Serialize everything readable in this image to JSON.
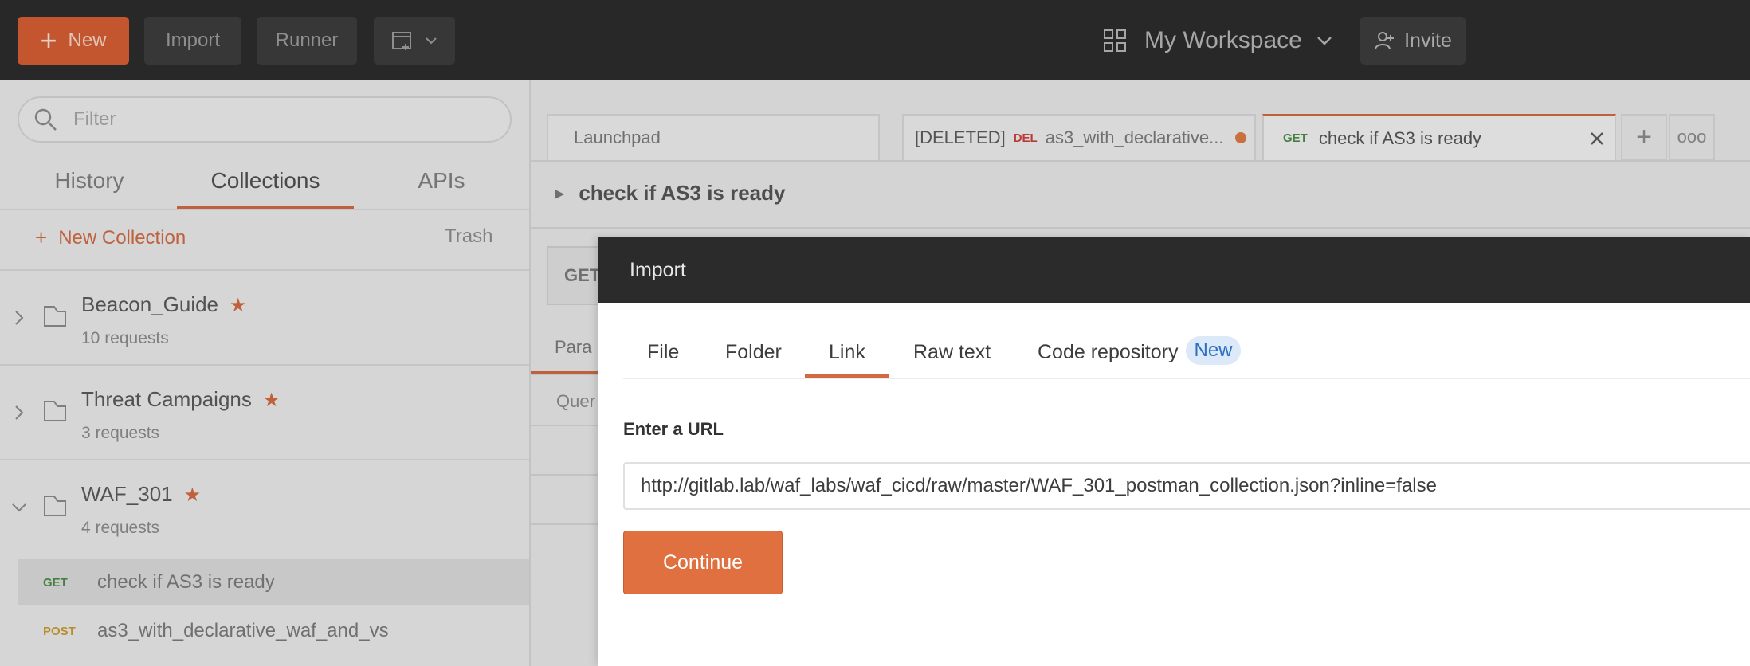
{
  "topbar": {
    "new_label": "New",
    "import_label": "Import",
    "runner_label": "Runner",
    "workspace_label": "My Workspace",
    "invite_label": "Invite"
  },
  "sidebar": {
    "filter_placeholder": "Filter",
    "tabs": [
      "History",
      "Collections",
      "APIs"
    ],
    "active_tab": "Collections",
    "new_collection_label": "New Collection",
    "trash_label": "Trash",
    "collections": [
      {
        "name": "Beacon_Guide",
        "requests": "10 requests",
        "starred": true,
        "expanded": false
      },
      {
        "name": "Threat Campaigns",
        "requests": "3 requests",
        "starred": true,
        "expanded": false
      },
      {
        "name": "WAF_301",
        "requests": "4 requests",
        "starred": true,
        "expanded": true
      }
    ],
    "requests": [
      {
        "method": "GET",
        "name": "check if AS3 is ready",
        "active": true
      },
      {
        "method": "POST",
        "name": "as3_with_declarative_waf_and_vs",
        "active": false
      }
    ]
  },
  "tabs": {
    "launchpad": "Launchpad",
    "deleted_prefix": "[DELETED]",
    "deleted_method": "DEL",
    "deleted_name": "as3_with_declarative...",
    "active_method": "GET",
    "active_name": "check if AS3 is ready"
  },
  "main": {
    "request_title": "check if AS3 is ready",
    "method": "GET",
    "params_tab": "Para",
    "query_label": "Quer"
  },
  "modal": {
    "title": "Import",
    "tabs": [
      "File",
      "Folder",
      "Link",
      "Raw text",
      "Code repository"
    ],
    "active_tab": "Link",
    "new_badge": "New",
    "url_label": "Enter a URL",
    "url_value": "http://gitlab.lab/waf_labs/waf_cicd/raw/master/WAF_301_postman_collection.json?inline=false",
    "continue_label": "Continue"
  },
  "colors": {
    "accent": "#d06a43",
    "topbar": "#2c2c2c",
    "get": "#4c8a4a",
    "post": "#c99a34",
    "delete": "#c9403a",
    "badge_bg": "#dbe9f9",
    "badge_text": "#2e6fc2"
  }
}
